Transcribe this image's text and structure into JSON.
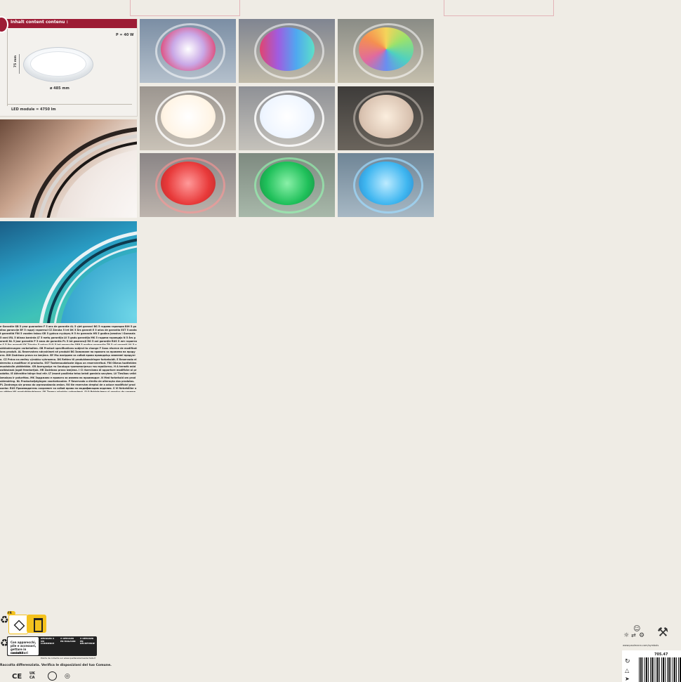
{
  "spec_card": {
    "header": "Inhalt  content  contenu :",
    "power": "P = 40 W",
    "height": "75 mm",
    "diameter": "ø 485 mm",
    "module": "LED module = 4750 lm"
  },
  "warranty_text": "e Garantie GB 5 year guarantee F 5 ans de garantie AL 5 vjet garanci BG 5 години гаранция BIH 5 godina garancije BY 5 гадоў гарантыі CZ Záruka 5 let DK 5 års garanti E 5 años de garantía EST 5 aastat garantiid FIN 5 vuoden takuu GR 5 χρόνια εγγύηση H 5 év garancia HR 5 godina jamstva I Garanzia 5 anni IRL 5 bliana baránta LT 5 metų garantija LV 5 gadu garantija MK 5 години гаранција N 5 års garanti NL 5 jaar garantie P 5 anos de garantia PL 5 lat gwarancji RO 5 ani garanție RUS 5 лет гарантии S 5 års garanti SK Záruka 5 rokov SLO 5 let garancije SRB 5 godina garancije TR 5 yıl garanti UA 5 років гарантії",
  "changes_text": "uktänderungen vorbehalten. GB Product specifications subject to change F Sous réserve de modifications produit. AL Rezervohen ndryshimet në produkt BG Запазване на правото за промени на продукта. BIH Zadržano pravo na izmjene. BY Мы пакідаем за сабой права праводзіць змяненні прадукта. CZ Právo na změny výrobku vyhrazeno. DK Retten til produktændringer forbeholdt. E Reservado el derecho a modificar el producto. EST Tootemuudatuste õigus on reserveeritud. FIN Oikeus tuotteiden muutoksiin pidätetään. GR Διατηρούμε το δικαίωμα τροποποιήσεων του προϊόντος. H A termék módosításának jogát fenntartjuk. HR Zadržano pravo izmjena. I Ci riserviamo di apportare modifiche al prodotto. IE Athraithe táirge faoi réir. LT Įmonė pasilieka teisę keisti gaminio savybes. LV Tiesības veikt izmaiņas ir paturētas. MK Задржано е правото за измени на производот. N Med forbehold om produktendring. NL Productwijzigingen voorbehouden. P Reservado o direito de alteração dos produtos. PL Zastrzega się prawo do wprowadzania zmian. RO Ne rezervăm dreptul de a aduce modificări produselor. RUS Производитель сохраняет за собой право на модификацию изделия. S Vi förbehåller oss rätten till produktändringar. SK Zmeny výrobku vyhradené. SLO Pridržujemo si pravico do sprememb proizvoda. SRB Zadržavamo pravo na izmene. TR Ürünle ilgili değişiklik yapma hakkı saklıdır. UA Виробник залишає за собою право на здійснення модифікацій продукту.",
  "recycle": {
    "badge": "FR",
    "label_line1": "Con apparecchi,",
    "label_line2": "pile e accessori,",
    "label_line3": "gettare in contenitori",
    "label_line4": "raccolta",
    "col1": "DÉPOSER À UN COMMERCE",
    "col2": "À DÉPOSER EN MAGASIN",
    "col3": "À DÉPOSER EN DÉCHÈTERIE",
    "footnote": "Points de collecte sur www.quefairedemesdechets.fr",
    "raccolta": "Raccolta differenziata. Verifica le disposizioni del tuo Comune.",
    "marks": [
      "CE",
      "UK CA"
    ]
  },
  "website": "www.paulmann.com/symbols",
  "article_no": "705.47",
  "colors": {
    "accent": "#9d1c35",
    "background": "#efece5"
  }
}
